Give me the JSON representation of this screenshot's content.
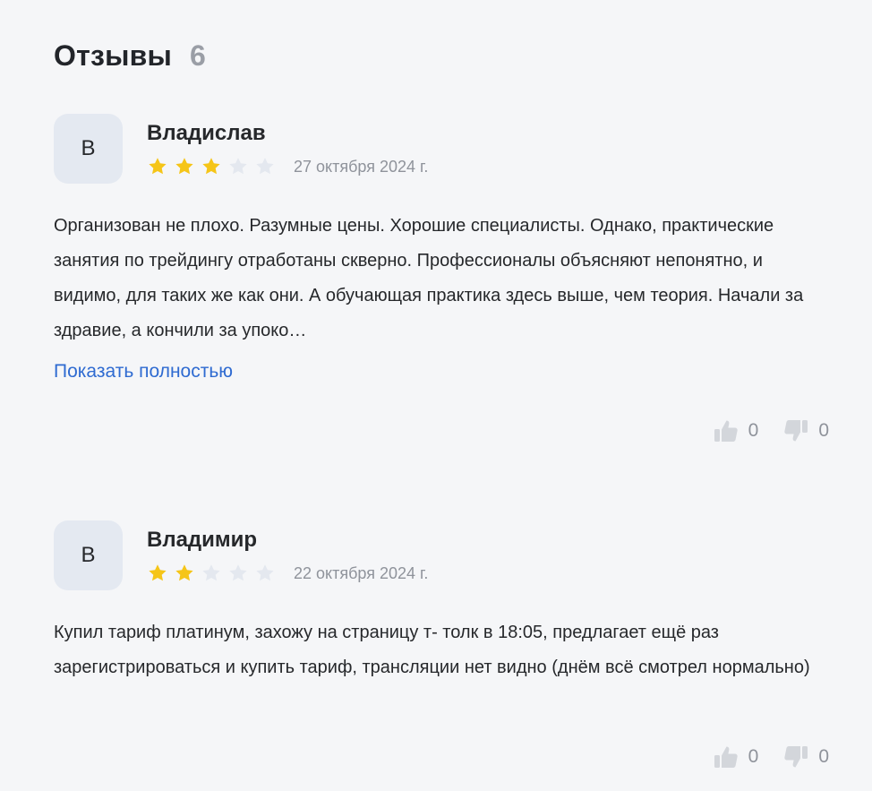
{
  "header": {
    "title": "Отзывы",
    "count": "6"
  },
  "colors": {
    "star_filled": "#f5c518",
    "star_empty": "#e4e8ef",
    "link": "#2f6bd1",
    "vote_icon": "#d3d6db"
  },
  "reviews": [
    {
      "avatar_letter": "В",
      "author": "Владислав",
      "rating": 3,
      "rating_max": 5,
      "date": "27 октября 2024 г.",
      "text": "Организован не плохо. Разумные цены. Хорошие специалисты. Однако, практические занятия по трейдингу отработаны скверно. Профессионалы объясняют непонятно, и видимо, для таких же как они. А обучающая практика здесь выше, чем теория. Начали за здравие, а кончили за упоко…",
      "show_more": "Показать полностью",
      "likes": "0",
      "dislikes": "0"
    },
    {
      "avatar_letter": "В",
      "author": "Владимир",
      "rating": 2,
      "rating_max": 5,
      "date": "22 октября 2024 г.",
      "text": "Купил тариф платинум, захожу на страницу т- толк в 18:05, предлагает ещё раз зарегистрироваться и купить тариф, трансляции нет видно (днём всё смотрел нормально)",
      "likes": "0",
      "dislikes": "0"
    }
  ]
}
